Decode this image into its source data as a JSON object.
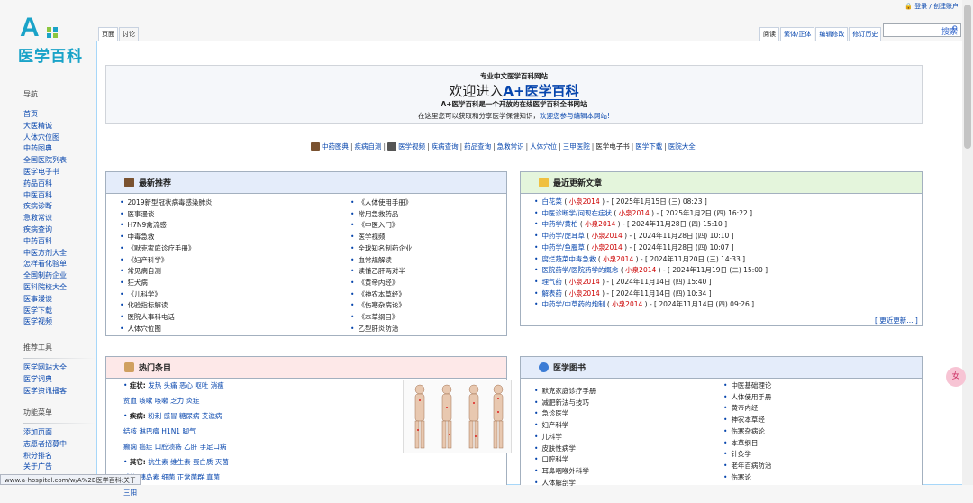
{
  "logo": {
    "mark": "A",
    "text": "医学百科"
  },
  "topright": {
    "icon": "lock-icon",
    "text": "登录 / 创建账户"
  },
  "tabs_left": [
    "页面",
    "讨论"
  ],
  "tabs_right": [
    "阅读",
    "繁体/正体",
    "编辑修改",
    "修订历史"
  ],
  "search": {
    "placeholder": "搜索",
    "icon": "search-icon"
  },
  "sidebar": {
    "nav_title": "导航",
    "nav": [
      "首页",
      "大医精诚",
      "人体穴位图",
      "中药图典",
      "全国医院列表",
      "医学电子书",
      "药品百科",
      "中医百科",
      "疾病诊断",
      "急救常识",
      "疾病查询",
      "中药百科",
      "中医方剂大全",
      "怎样看化验单",
      "全国制药企业",
      "医科院校大全",
      "医事漫谈",
      "医学下载",
      "医学视频"
    ],
    "tools_title": "推荐工具",
    "tools": [
      "医学网站大全",
      "医学词典",
      "医学资讯播客"
    ],
    "func_title": "功能菜单",
    "func": [
      "添加页面",
      "志愿者招募中",
      "积分排名",
      "关于广告",
      "联系我们"
    ]
  },
  "welcome": {
    "line1": "专业中文医学百科网站",
    "line2_pre": "欢迎进入",
    "line2_brand": "A+医学百科",
    "line3": "A+医学百科是一个开放的在线医学百科全书网站",
    "line4_pre": "在这里您可以获取和分享医学保健知识，",
    "line4_link": "欢迎您参与编辑本网站!"
  },
  "quicknav": [
    "中药图典",
    "疾病自测",
    "医学视频",
    "疾病查询",
    "药品查询",
    "急救常识",
    "人体穴位",
    "三甲医院",
    "医学电子书",
    "医学下载",
    "医院大全"
  ],
  "featured": {
    "title": "最新推荐",
    "col1": [
      "2019新型冠状病毒感染肺炎",
      "医事漫谈",
      "H7N9禽流感",
      "中毒急救",
      "《默克家庭诊疗手册》",
      "《妇产科学》",
      "常见病自测",
      "狂犬病",
      "《儿科学》",
      "化验指标解读",
      "医院人事科电话",
      "人体穴位图"
    ],
    "col2": [
      "《人体使用手册》",
      "常用急救药品",
      "《中医入门》",
      "医学视频",
      "全球知名制药企业",
      "血常规解读",
      "读懂乙肝两对半",
      "《黄帝内经》",
      "《神农本草经》",
      "《伤寒杂病论》",
      "《本草纲目》",
      "乙型肝炎防治"
    ]
  },
  "recent": {
    "title": "最近更新文章",
    "more": "[ 更近更新... ]",
    "items": [
      {
        "t": "白花菜",
        "u": "小泉2014",
        "d": "2025年1月15日 (三) 08:23"
      },
      {
        "t": "中医诊断学/问现在症状",
        "u": "小泉2014",
        "d": "2025年1月2日 (四) 16:22"
      },
      {
        "t": "中药学/黄柏",
        "u": "小泉2014",
        "d": "2024年11月28日 (四) 15:10"
      },
      {
        "t": "中药学/虎耳草",
        "u": "小泉2014",
        "d": "2024年11月28日 (四) 10:10"
      },
      {
        "t": "中药学/鱼腥草",
        "u": "小泉2014",
        "d": "2024年11月28日 (四) 10:07"
      },
      {
        "t": "腐烂蔬菜中毒急救",
        "u": "小泉2014",
        "d": "2024年11月20日 (三) 14:33"
      },
      {
        "t": "医院药学/医院药学的概念",
        "u": "小泉2014",
        "d": "2024年11月19日 (二) 15:00"
      },
      {
        "t": "理气药",
        "u": "小泉2014",
        "d": "2024年11月14日 (四) 15:40"
      },
      {
        "t": "解表药",
        "u": "小泉2014",
        "d": "2024年11月14日 (四) 10:34"
      },
      {
        "t": "中药学/中草药的炮制",
        "u": "小泉2014",
        "d": "2024年11月14日 (四) 09:26"
      }
    ]
  },
  "hot": {
    "title": "热门条目",
    "rows": [
      {
        "label": "症状:",
        "items": [
          "发热",
          "头痛",
          "恶心",
          "呕吐",
          "消瘦"
        ]
      },
      {
        "label": "",
        "items": [
          "贫血",
          "咳嗽",
          "咳嗽",
          "乏力",
          "炎症"
        ]
      },
      {
        "label": "疾病:",
        "items": [
          "粉刺",
          "感冒",
          "糖尿病",
          "艾滋病"
        ]
      },
      {
        "label": "",
        "items": [
          "结核",
          "淋巴瘤",
          "H1N1",
          "脚气"
        ]
      },
      {
        "label": "",
        "items": [
          "癫痫",
          "癌症",
          "口腔溃疡",
          "乙肝",
          "手足口病"
        ]
      },
      {
        "label": "其它:",
        "items": [
          "抗生素",
          "维生素",
          "蛋白质",
          "灭菌"
        ]
      },
      {
        "label": "",
        "items": [
          "感染",
          "胰岛素",
          "细菌",
          "正常菌群",
          "真菌"
        ]
      },
      {
        "label": "",
        "items": [
          "三阳"
        ]
      }
    ]
  },
  "books": {
    "title": "医学图书",
    "col1": [
      "默克家庭诊疗手册",
      "减肥新法与技巧",
      "急诊医学",
      "妇产科学",
      "儿科学",
      "皮肤性病学",
      "口腔科学",
      "耳鼻咽喉外科学",
      "人体解剖学"
    ],
    "col2": [
      "中医基础理论",
      "人体使用手册",
      "黄帝内经",
      "神农本草经",
      "伤寒杂病论",
      "本草纲目",
      "针灸学",
      "老年百病防治",
      "伤寒论"
    ]
  },
  "status": "www.a-hospital.com/w/A%2B医学百科:关于",
  "bubble": "女"
}
